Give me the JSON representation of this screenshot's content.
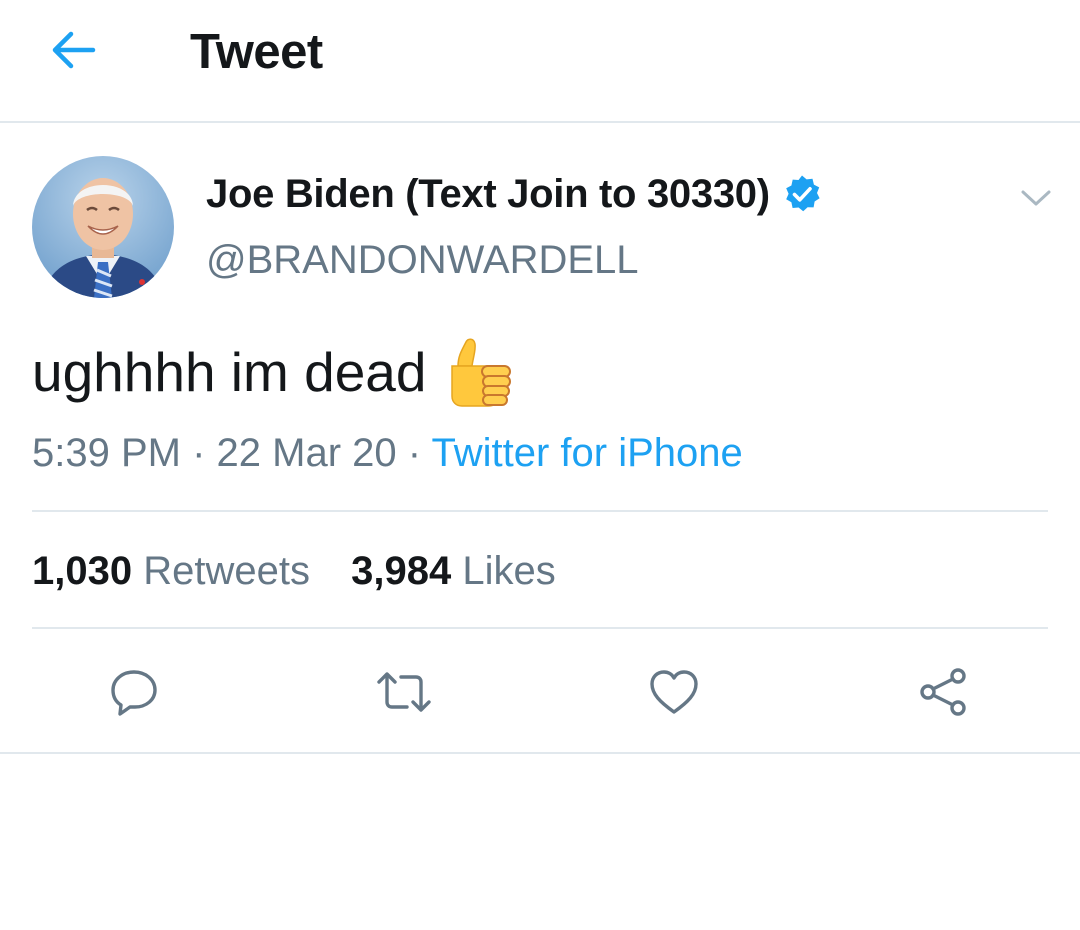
{
  "header": {
    "title": "Tweet",
    "back_icon": "arrow-left-icon"
  },
  "colors": {
    "accent": "#1da1f2",
    "text": "#14171a",
    "muted": "#657786",
    "divider": "#e1e8ed"
  },
  "tweet": {
    "author": {
      "name": "Joe Biden (Text Join to 30330)",
      "handle": "@BRANDONWARDELL",
      "verified": true
    },
    "text": "ughhhh im dead",
    "emoji": "thumbs-up-emoji",
    "time": "5:39 PM",
    "separator": "·",
    "date": "22 Mar 20",
    "source": "Twitter for iPhone",
    "retweets": {
      "count": "1,030",
      "label": "Retweets"
    },
    "likes": {
      "count": "3,984",
      "label": "Likes"
    }
  },
  "actions": [
    "reply-icon",
    "retweet-icon",
    "like-icon",
    "share-icon"
  ]
}
